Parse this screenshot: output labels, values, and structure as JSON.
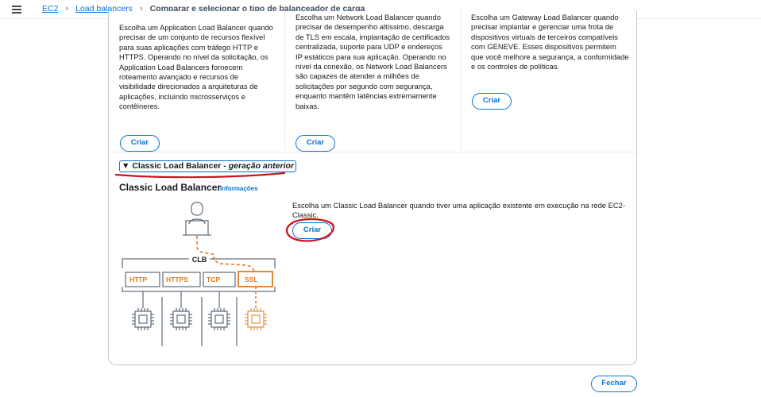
{
  "breadcrumb": {
    "items": [
      "EC2",
      "Load balancers"
    ],
    "current": "Comparar e selecionar o tipo de balanceador de carga"
  },
  "alb": {
    "description": "Escolha um Application Load Balancer quando precisar de um conjunto de recursos flexível para suas aplicações com tráfego HTTP e HTTPS. Operando no nível da solicitação, os Application Load Balancers fornecem roteamento avançado e recursos de visibilidade direcionados a arquiteturas de aplicações, incluindo microsserviços e contêineres.",
    "button": "Criar"
  },
  "nlb": {
    "description": "Escolha um Network Load Balancer quando precisar de desempenho altíssimo, descarga de TLS em escala, implantação de certificados centralizada, suporte para UDP e endereços IP estáticos para sua aplicação. Operando no nível da conexão, os Network Load Balancers são capazes de atender a milhões de solicitações por segundo com segurança, enquanto mantêm latências extremamente baixas.",
    "button": "Criar"
  },
  "gwlb": {
    "description": "Escolha um Gateway Load Balancer quando precisar implantar e gerenciar uma frota de dispositivos virtuais de terceiros compatíveis com GENEVE. Esses dispositivos permitem que você melhore a segurança, a conformidade e os controles de políticas.",
    "button": "Criar"
  },
  "classic": {
    "expander_label": "Classic Load Balancer - ",
    "expander_italic": "geração anterior",
    "title": "Classic Load Balancer",
    "info": "Informações",
    "description": "Escolha um Classic Load Balancer quando tiver uma aplicação existente em execução na rede EC2-Classic.",
    "button": "Criar",
    "diagram": {
      "clb_label": "CLB",
      "protocols": [
        "HTTP",
        "HTTPS",
        "TCP",
        "SSL"
      ],
      "highlight": "SSL"
    }
  },
  "footer": {
    "close": "Fechar"
  },
  "colors": {
    "accent": "#0972d3",
    "orange": "#e07b1f",
    "annotation": "#d1131f"
  },
  "icons": [
    "menu-icon",
    "user-laptop-icon",
    "chip-icon"
  ]
}
